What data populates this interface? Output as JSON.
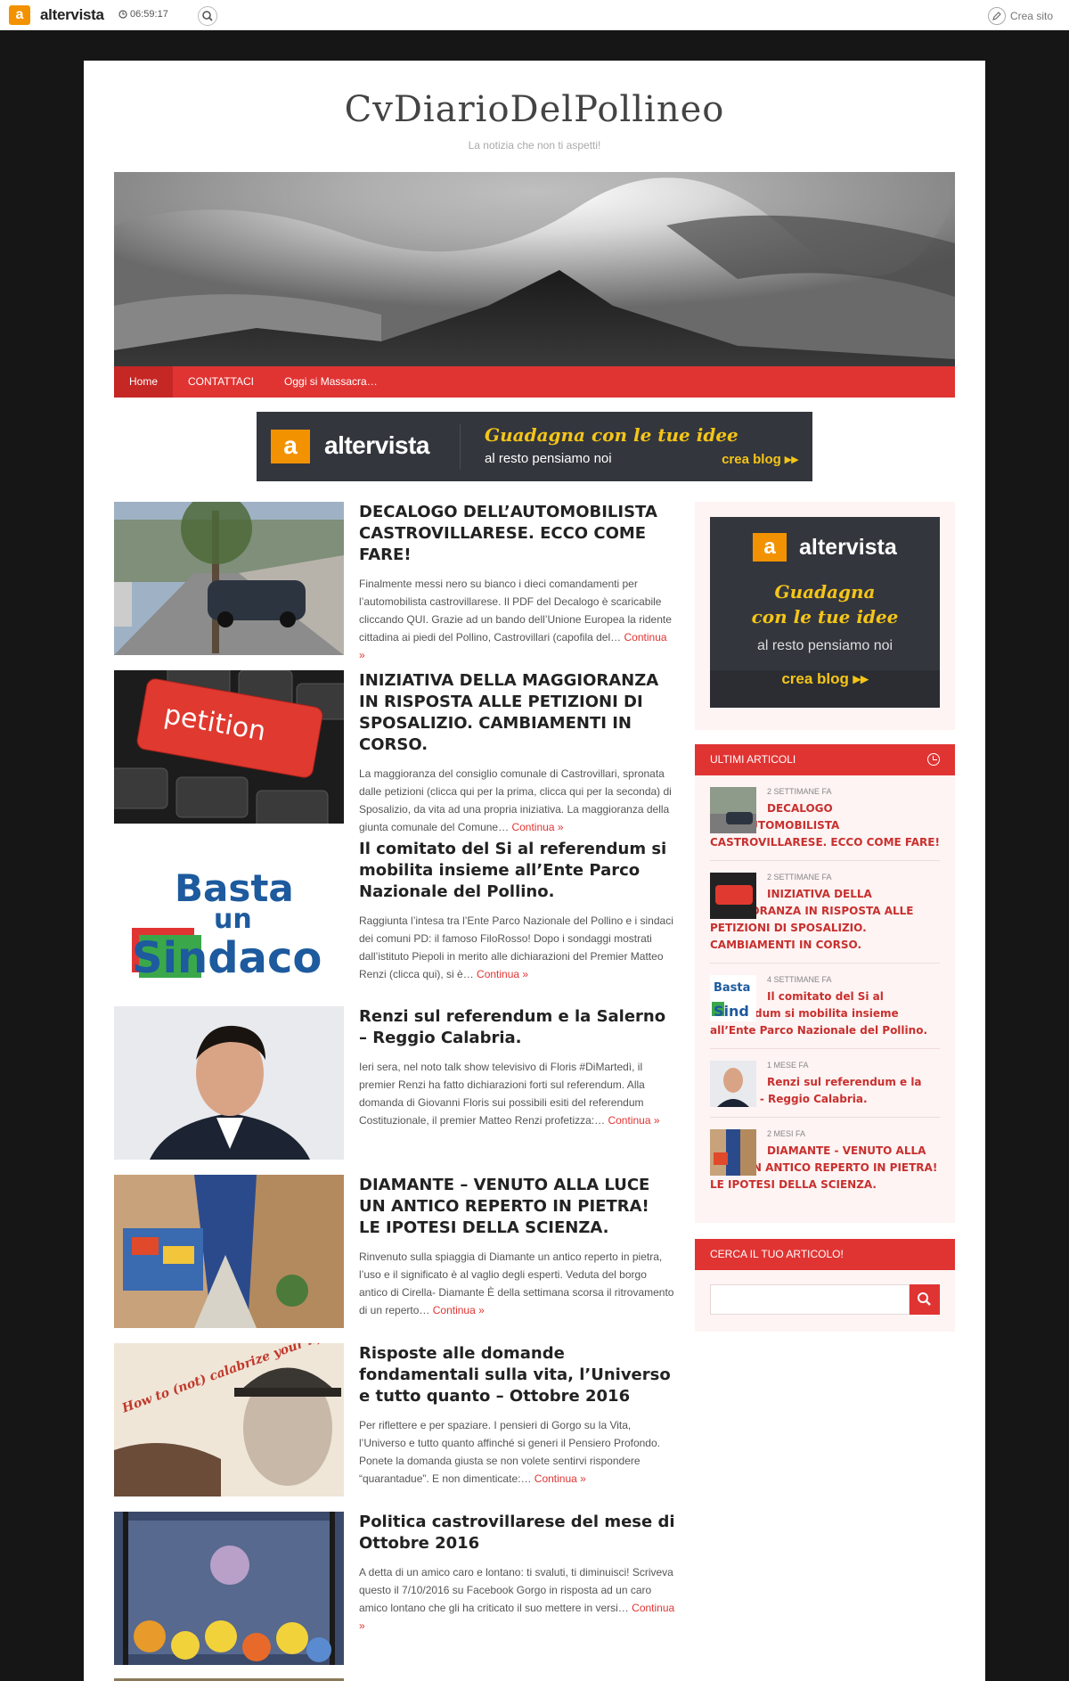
{
  "topbar": {
    "logo_letter": "a",
    "brand": "altervista",
    "clock": "06:59:17",
    "create_site": "Crea sito"
  },
  "site": {
    "title": "CvDiarioDelPollineo",
    "tagline": "La notizia che non ti aspetti!"
  },
  "nav": {
    "items": [
      {
        "label": "Home"
      },
      {
        "label": "CONTATTACI"
      },
      {
        "label": "Oggi si Massacra…"
      }
    ]
  },
  "banner": {
    "logo_letter": "a",
    "brand": "altervista",
    "slogan_line1": "Guadagna con le tue idee",
    "slogan_line2": "al resto pensiamo noi",
    "cta": "crea blog ▸▸"
  },
  "posts": [
    {
      "title": "DECALOGO DELL’AUTOMOBILISTA CASTROVILLARESE. ECCO COME FARE!",
      "excerpt": "Finalmente messi nero su bianco  i dieci comandamenti per l’automobilista castrovillarese. Il PDF del Decalogo è scaricabile cliccando QUI. Grazie ad un bando dell’Unione Europea la ridente cittadina ai piedi del Pollino,  Castrovillari (capofila del…",
      "more": "Continua »"
    },
    {
      "title": "INIZIATIVA DELLA MAGGIORANZA IN RISPOSTA ALLE PETIZIONI DI SPOSALIZIO. CAMBIAMENTI IN CORSO.",
      "excerpt": "La maggioranza del consiglio comunale di Castrovillari, spronata dalle petizioni (clicca qui per la prima, clicca qui per la seconda) di Sposalizio, da vita ad una propria iniziativa. La maggioranza della giunta comunale del Comune…",
      "more": "Continua »"
    },
    {
      "title": "Il comitato del Si al referendum si mobilita insieme all’Ente Parco Nazionale del Pollino.",
      "excerpt": "Raggiunta l’intesa tra l’Ente Parco Nazionale del Pollino e i sindaci dei comuni PD: il famoso FiloRosso! Dopo i sondaggi mostrati dall’istituto Piepoli in merito alle dichiarazioni del Premier Matteo Renzi (clicca qui), si è…",
      "more": "Continua »"
    },
    {
      "title": "Renzi sul referendum e la Salerno – Reggio Calabria.",
      "excerpt": "Ieri sera, nel noto talk show televisivo di Floris #DiMartedì, il premier Renzi ha fatto dichiarazioni forti sul referendum. Alla domanda di Giovanni Floris sui possibili esiti del referendum Costituzionale, il premier Matteo Renzi profetizza:…",
      "more": "Continua »"
    },
    {
      "title": "DIAMANTE – VENUTO ALLA LUCE UN ANTICO REPERTO IN PIETRA! LE IPOTESI DELLA SCIENZA.",
      "excerpt": "Rinvenuto sulla spiaggia di Diamante un antico reperto in pietra, l’uso e il significato è al vaglio degli esperti. Veduta del borgo antico di Cirella- Diamante È della settimana scorsa il ritrovamento di un reperto…",
      "more": "Continua »"
    },
    {
      "title": "Risposte alle domande fondamentali sulla vita, l’Universo e tutto quanto – Ottobre 2016",
      "excerpt": "Per riflettere e per spaziare. I pensieri di Gorgo su la Vita, l’Universo e tutto quanto affinché si generi il Pensiero Profondo. Ponete la domanda giusta se non volete sentirvi rispondere “quarantadue”. E non dimenticate:…",
      "more": "Continua »"
    },
    {
      "title": "Politica castrovillarese del mese di Ottobre 2016",
      "excerpt": "A detta di un amico caro e lontano: ti svaluti, ti diminuisci! Scriveva questo il 7/10/2016 su Facebook Gorgo in risposta ad un caro amico lontano che gli ha criticato il suo mettere in versi…",
      "more": "Continua »"
    }
  ],
  "thumb_text": {
    "petition": "petition",
    "basta_line1": "Basta",
    "basta_line2": "un",
    "basta_line3": "Sindaco",
    "howto": "How to (not) calabrize your life"
  },
  "sidebar": {
    "ad": {
      "logo_letter": "a",
      "brand": "altervista",
      "slogan_line1": "Guadagna",
      "slogan_line2": "con le tue idee",
      "slogan_line3": "al resto pensiamo noi",
      "cta": "crea blog ▸▸"
    },
    "recent_title": "ULTIMI ARTICOLI",
    "recent": [
      {
        "meta": "2 SETTIMANE FA",
        "title": "DECALOGO DELL’AUTOMOBILISTA CASTROVILLARESE. ECCO COME FARE!"
      },
      {
        "meta": "2 SETTIMANE FA",
        "title": "INIZIATIVA DELLA MAGGIORANZA IN RISPOSTA ALLE PETIZIONI DI SPOSALIZIO. CAMBIAMENTI IN CORSO."
      },
      {
        "meta": "4 SETTIMANE FA",
        "title": "Il comitato del Si al referendum si mobilita insieme all’Ente Parco Nazionale del Pollino."
      },
      {
        "meta": "1 MESE FA",
        "title": "Renzi sul referendum e la Salerno - Reggio Calabria."
      },
      {
        "meta": "2 MESI FA",
        "title": "DIAMANTE - VENUTO ALLA LUCE UN ANTICO REPERTO IN PIETRA! LE IPOTESI DELLA SCIENZA."
      }
    ],
    "search_title": "CERCA IL TUO ARTICOLO!",
    "search_placeholder": ""
  },
  "colors": {
    "accent": "#e03433",
    "accent_dark": "#c52725",
    "brand_orange": "#f39200",
    "ad_yellow": "#f5c518",
    "ad_bg": "#33363d"
  },
  "icons": {
    "clock": "clock-icon",
    "search": "search-icon",
    "pen": "pencil-icon"
  }
}
